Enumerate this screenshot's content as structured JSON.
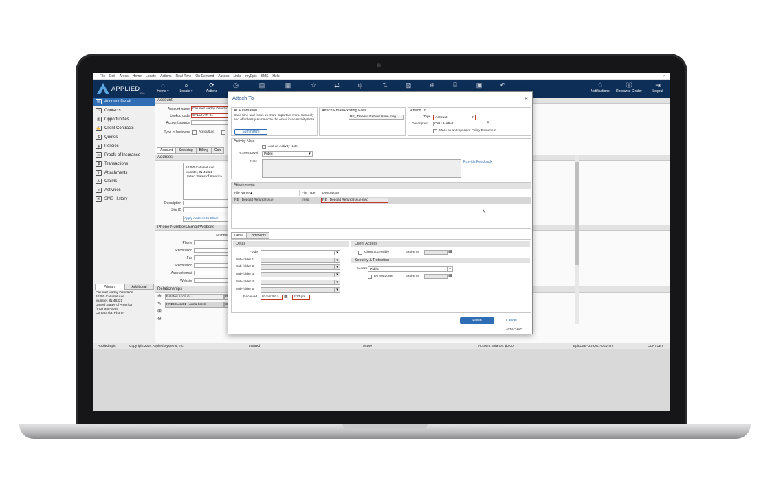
{
  "menubar": {
    "items": [
      "File",
      "Edit",
      "Areas",
      "Home",
      "Locate",
      "Actions",
      "Real-Time",
      "On Demand",
      "Access",
      "Links",
      "myEpic",
      "SMS",
      "Help"
    ],
    "close": "×"
  },
  "ribbon": {
    "brand": "APPLIED",
    "brand_sub": "Epic",
    "left_buttons": [
      "Home ▾",
      "Locate ▾",
      "Actions"
    ],
    "right_buttons": [
      "Notifications",
      "Resource Center",
      "Logout"
    ]
  },
  "leftnav": {
    "items": [
      {
        "label": "Account Detail",
        "active": true
      },
      {
        "label": "Contacts"
      },
      {
        "label": "Opportunities"
      },
      {
        "label": "Client Contracts"
      },
      {
        "label": "Quotes"
      },
      {
        "label": "Policies"
      },
      {
        "label": "Proofs of Insurance"
      },
      {
        "label": "Transactions"
      },
      {
        "label": "Attachments"
      },
      {
        "label": "Claims"
      },
      {
        "label": "Activities"
      },
      {
        "label": "SMS History"
      }
    ],
    "tabs": [
      "Primary",
      "Additional"
    ],
    "contact_lines": [
      "Calumet Harley Davidson",
      "10350 Calumet Ave.",
      "Munster, IN 46321",
      "United States of America",
      "(973) 555-6054",
      "Contact via: Phone"
    ]
  },
  "account": {
    "section": "Account",
    "name_label": "Account name",
    "name_value": "Calumet Harley Davidson",
    "lookup_label": "Lookup code",
    "lookup_value": "CALUHAR-01",
    "source_label": "Account source",
    "type_label": "Type of business",
    "agriculture": "Agriculture",
    "co": "Co",
    "subtabs": [
      "Account",
      "Servicing",
      "Billing",
      "Con"
    ],
    "address_header": "Address",
    "address_lines": [
      "10350 Calumet Ave.",
      "Munster, IN 46321",
      "United States of America"
    ],
    "description_label": "Description",
    "site_label": "Site ID",
    "apply_address": "Apply Address to Other",
    "phone_header": "Phone Numbers/Email/Website",
    "number_label": "Number",
    "phone_fields": [
      "Phone",
      "Permission",
      "Fax",
      "Permission",
      "Account email",
      "Website"
    ],
    "relationships_header": "Relationships",
    "related_account_col": "Related Account",
    "related_row": "KREISLAN01 - Anna Kreisl",
    "r_col": "R",
    "c_col": "C"
  },
  "statusbar": {
    "app": "Applied Epic",
    "copyright": "Copyright 2024 Applied Systems, Inc.",
    "insured": "Insured",
    "active": "Active",
    "balance": "Account Balance: $0.00",
    "env": "EpicDSB-US-QA1-DEVINT",
    "user": "CUNTDET"
  },
  "modal": {
    "title": "Attach To",
    "close": "×",
    "ai": {
      "header": "AI Automation",
      "text": "Save time and focus on more important work. Securely and effortlessly summarize the email in an Activity Note.",
      "button": "Summarize"
    },
    "email": {
      "header": "Attach Email/Existing Files",
      "file": "RE_ Deposit Refund Issue.msg"
    },
    "attach_to": {
      "header": "Attach To",
      "type_label": "Type",
      "type_value": "Account",
      "desc_label": "Description",
      "desc_value": "CALUHAR-01",
      "important": "Mark as an Important Policy Document"
    },
    "activity_note": {
      "header": "Activity Note",
      "add_label": "Add an Activity Note",
      "access_label": "Access Level",
      "access_value": "Public",
      "note_label": "Note",
      "feedback": "Provide Feedback"
    },
    "attachments": {
      "header": "Attachments",
      "columns": [
        "File Name",
        "File Type",
        "Description"
      ],
      "row": {
        "name": "RE_ Deposit Refund Issue",
        "type": ".msg",
        "desc": "RE_ Deposit Refund Issue.msg"
      }
    },
    "tabs": [
      "Detail",
      "Comments"
    ],
    "detail": {
      "header": "Detail",
      "folder_label": "Folder",
      "subfolders": [
        "Sub-folder 1",
        "Sub-folder 2",
        "Sub-folder 3",
        "Sub-folder 4",
        "Sub-folder 5"
      ],
      "received_label": "Received",
      "received_date": "07/16/2024",
      "received_time": "2:23 pm"
    },
    "client_access": {
      "header": "Client Access",
      "accessible": "Client accessible",
      "expire_label": "Expire on"
    },
    "security": {
      "header": "Security & Retention",
      "access_label": "Access",
      "access_value": "Public",
      "purge": "Do not purge",
      "expire_label": "Expire on"
    },
    "finish": "Finish",
    "cancel": "Cancel",
    "attached": "ATTACHAD"
  },
  "colors": {
    "ribbon": "#0d2e57",
    "accent": "#2f6db5",
    "required": "#c0392b"
  }
}
